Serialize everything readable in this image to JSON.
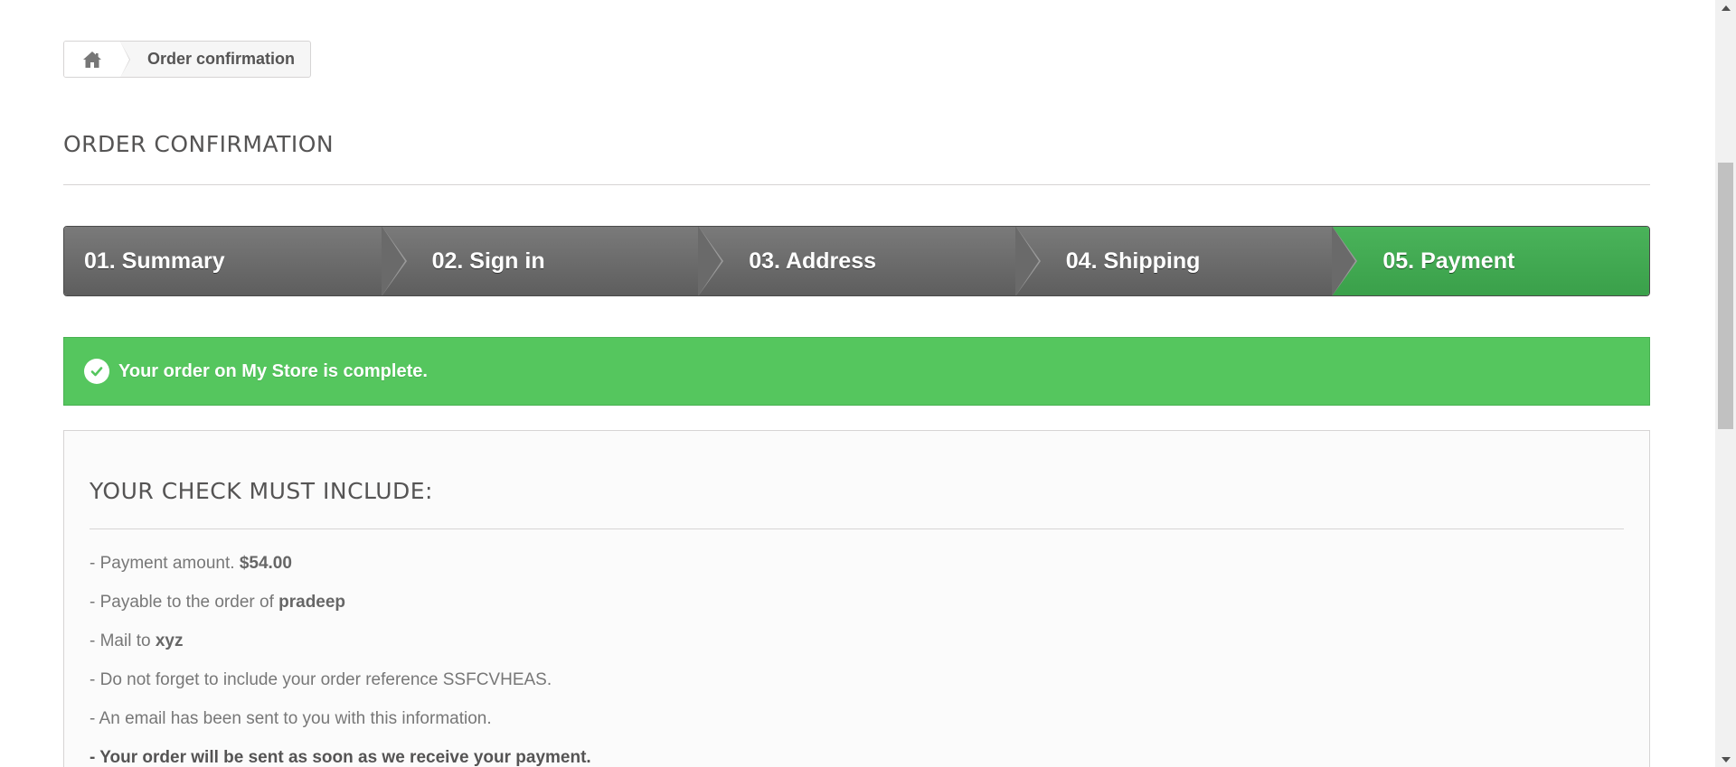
{
  "breadcrumb": {
    "home_icon": "home-icon",
    "current": "Order confirmation"
  },
  "heading": "ORDER CONFIRMATION",
  "steps": [
    {
      "label": "01. Summary",
      "active": false
    },
    {
      "label": "02. Sign in",
      "active": false
    },
    {
      "label": "03. Address",
      "active": false
    },
    {
      "label": "04. Shipping",
      "active": false
    },
    {
      "label": "05. Payment",
      "active": true
    }
  ],
  "alert": {
    "icon": "check-circle-icon",
    "text": "Your order on My Store is complete."
  },
  "check_box": {
    "title": "YOUR CHECK MUST INCLUDE:",
    "payment_prefix": "- Payment amount.",
    "payment_amount": "$54.00",
    "payable_prefix": "- Payable to the order of",
    "payable_name": "pradeep",
    "mail_prefix": "- Mail to",
    "mail_to": "xyz",
    "reference_line": "- Do not forget to include your order reference SSFCVHEAS.",
    "email_line": "- An email has been sent to you with this information.",
    "sent_line": "- Your order will be sent as soon as we receive your payment."
  },
  "colors": {
    "accent_green": "#55c65e",
    "step_active": "#46b157",
    "step_inactive": "#6c6c6c"
  }
}
